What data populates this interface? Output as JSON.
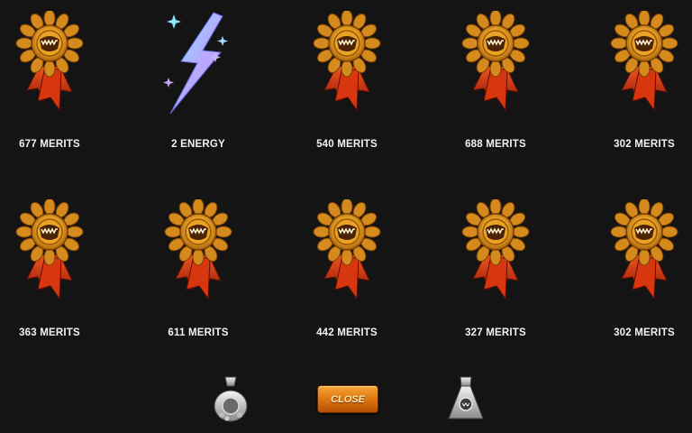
{
  "rewards": [
    {
      "label": "677 MERITS",
      "icon": "medal-icon"
    },
    {
      "label": "2 ENERGY",
      "icon": "energy-bolt-icon"
    },
    {
      "label": "540 MERITS",
      "icon": "medal-icon"
    },
    {
      "label": "688 MERITS",
      "icon": "medal-icon"
    },
    {
      "label": "302 MERITS",
      "icon": "medal-icon"
    },
    {
      "label": "363 MERITS",
      "icon": "medal-icon"
    },
    {
      "label": "611 MERITS",
      "icon": "medal-icon"
    },
    {
      "label": "442 MERITS",
      "icon": "medal-icon"
    },
    {
      "label": "327 MERITS",
      "icon": "medal-icon"
    },
    {
      "label": "302 MERITS",
      "icon": "medal-icon"
    }
  ],
  "footer": {
    "close_label": "CLOSE",
    "left_icon": "coin-bag-icon",
    "right_icon": "loot-bag-icon"
  },
  "colors": {
    "background": "#141414",
    "medal_gold": "#e8a526",
    "ribbon_red": "#c4260e",
    "button_orange": "#e07a12"
  }
}
